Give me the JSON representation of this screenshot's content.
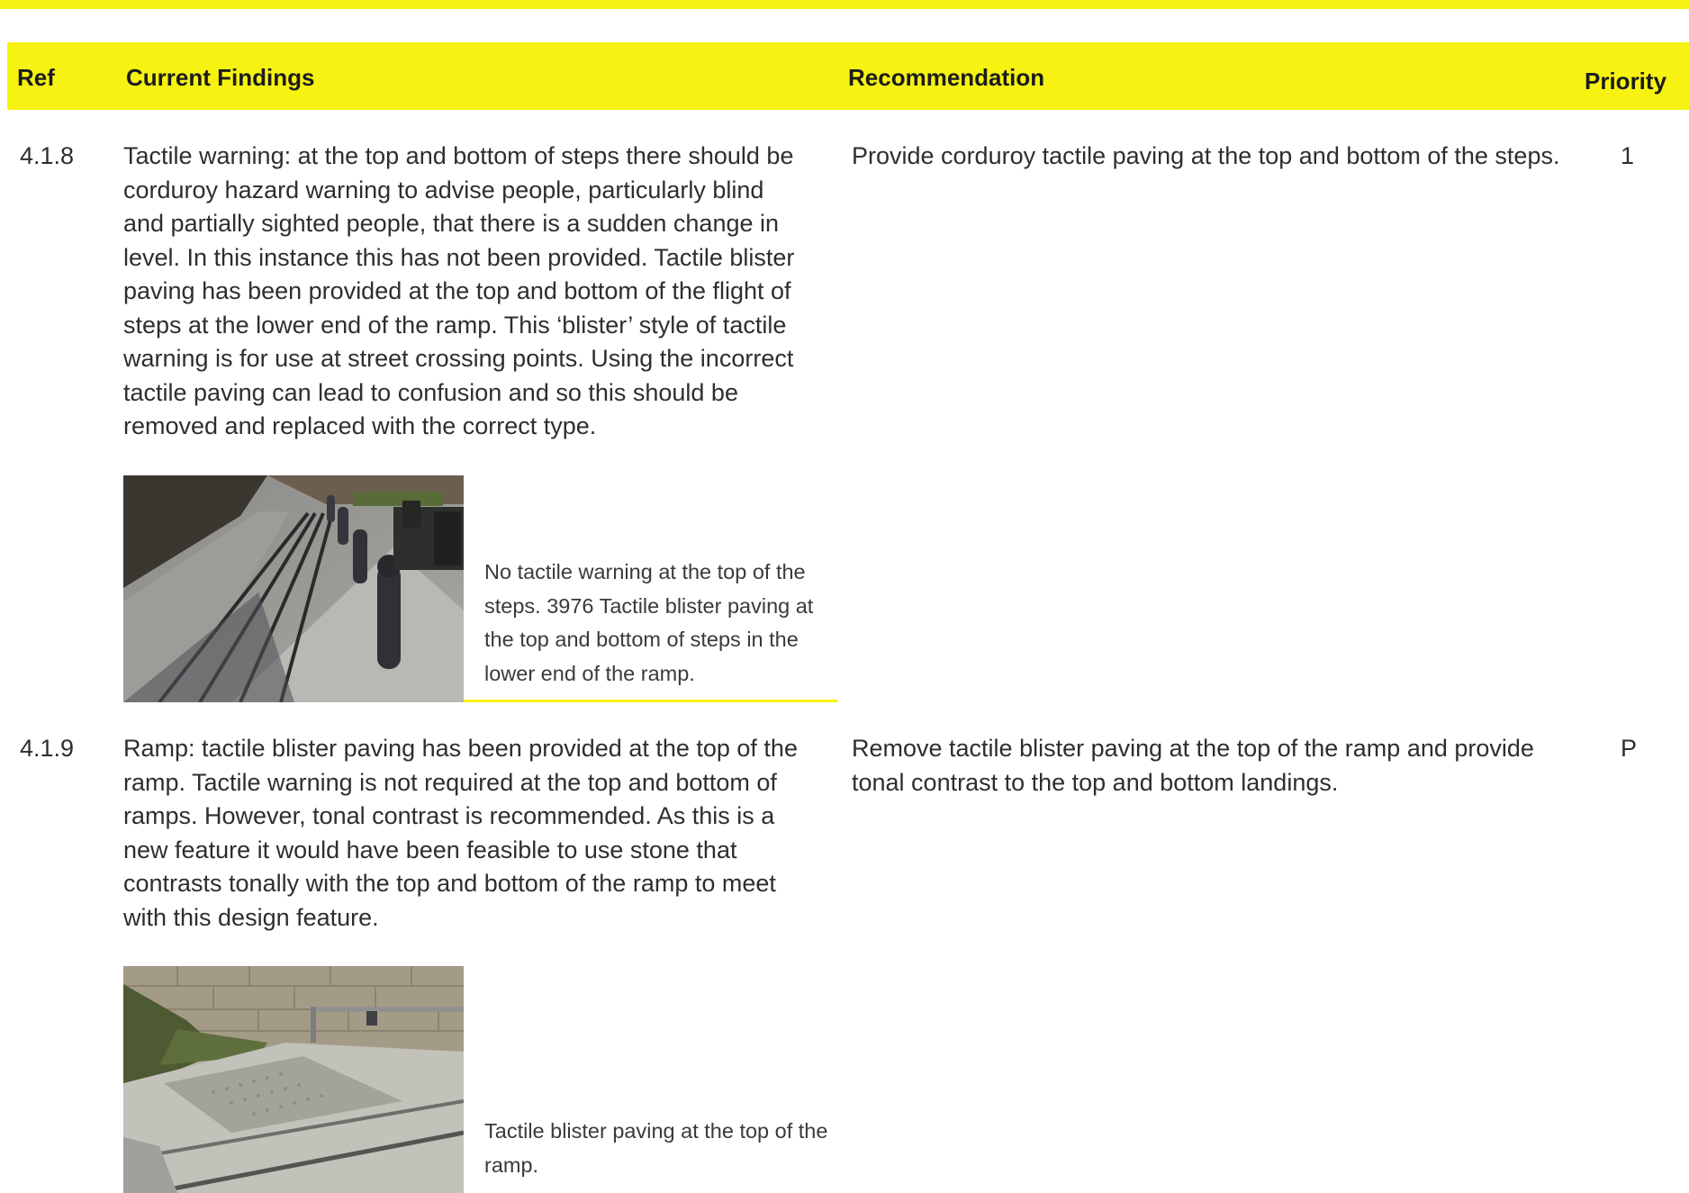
{
  "accent_color": "#f6f312",
  "header": {
    "ref": "Ref",
    "findings": "Current Findings",
    "recommendation": "Recommendation",
    "priority": "Priority"
  },
  "rows": [
    {
      "ref": "4.1.8",
      "finding": "Tactile warning: at the top and bottom of steps there should be corduroy hazard warning to advise people, particularly blind and partially sighted people, that there is a sudden change in level. In this instance this has not been provided. Tactile blister paving has been provided at the top and bottom of the flight of steps at the lower end of the ramp. This ‘blister’ style of tactile warning is for use at street crossing points. Using the incorrect tactile paving can lead to confusion and so this should be removed and replaced with the correct type.",
      "caption": "No tactile warning at the top of the steps. 3976 Tactile blister paving at the top and bottom of steps in the lower end of the ramp.",
      "recommendation": "Provide corduroy tactile paving at the top and bottom of the steps.",
      "priority": "1"
    },
    {
      "ref": "4.1.9",
      "finding": "Ramp: tactile blister paving has been provided at the top of the ramp. Tactile warning is not required at the top and bottom of ramps. However, tonal contrast is recommended. As this is a new feature it would have been feasible to use stone that contrasts tonally with the top and bottom of the ramp to meet with this design feature.",
      "caption": "Tactile blister paving at the top of the ramp.",
      "recommendation": "Remove tactile blister paving at the top of the ramp and provide tonal contrast to the top and bottom landings.",
      "priority": "P"
    }
  ]
}
